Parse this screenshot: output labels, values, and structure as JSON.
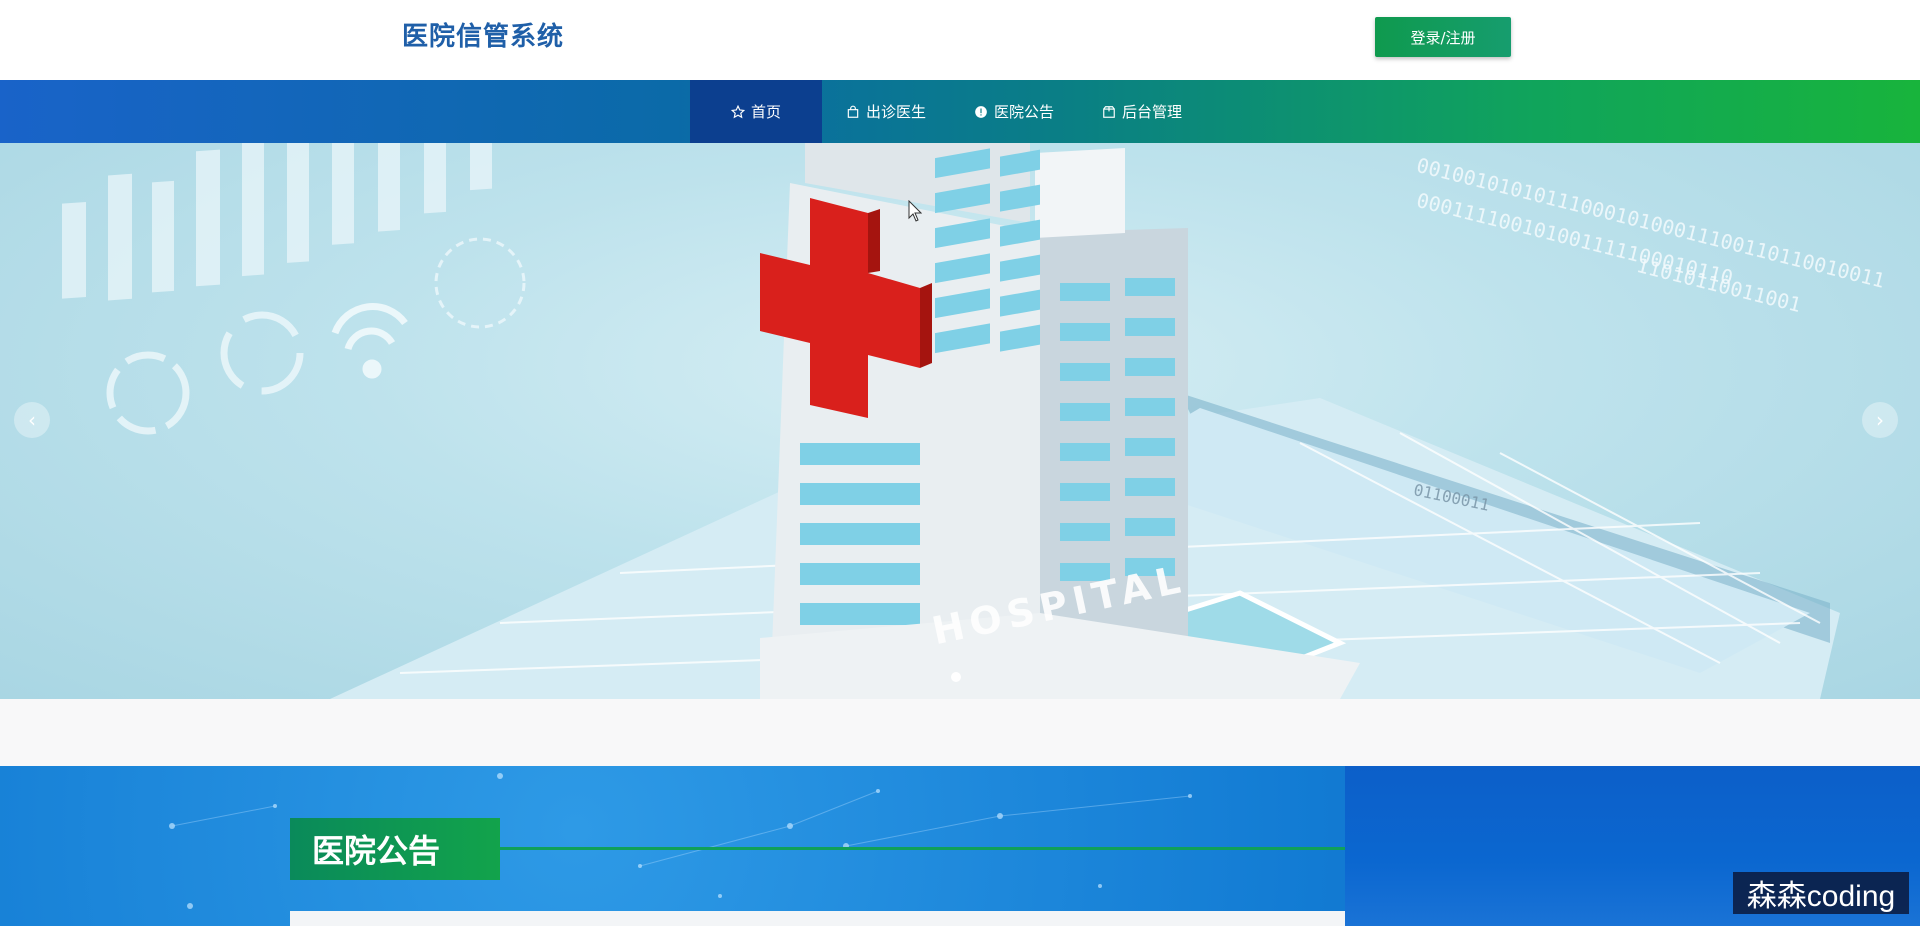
{
  "header": {
    "logo_text": "医院信管系统",
    "login_button": "登录/注册"
  },
  "nav": {
    "items": [
      {
        "label": "首页",
        "icon": "star-icon",
        "active": true
      },
      {
        "label": "出诊医生",
        "icon": "bag-icon",
        "active": false
      },
      {
        "label": "医院公告",
        "icon": "info-icon",
        "active": false
      },
      {
        "label": "后台管理",
        "icon": "package-icon",
        "active": false
      }
    ]
  },
  "banner": {
    "prev_arrow": "‹",
    "next_arrow": "›",
    "binary_line_1": "0010010101011100010100011100110110010011",
    "binary_line_2": "000111100101001111100010110",
    "binary_line_3": "11010110011001",
    "sign_text": "HOSPITAL",
    "tablet_text": "01100011"
  },
  "notice": {
    "title": "医院公告"
  },
  "watermark": "森森coding",
  "colors": {
    "brand_blue": "#1f5fa8",
    "nav_active": "#0c3f8f",
    "accent_green": "#10a45b",
    "cross_red": "#d9201c"
  }
}
